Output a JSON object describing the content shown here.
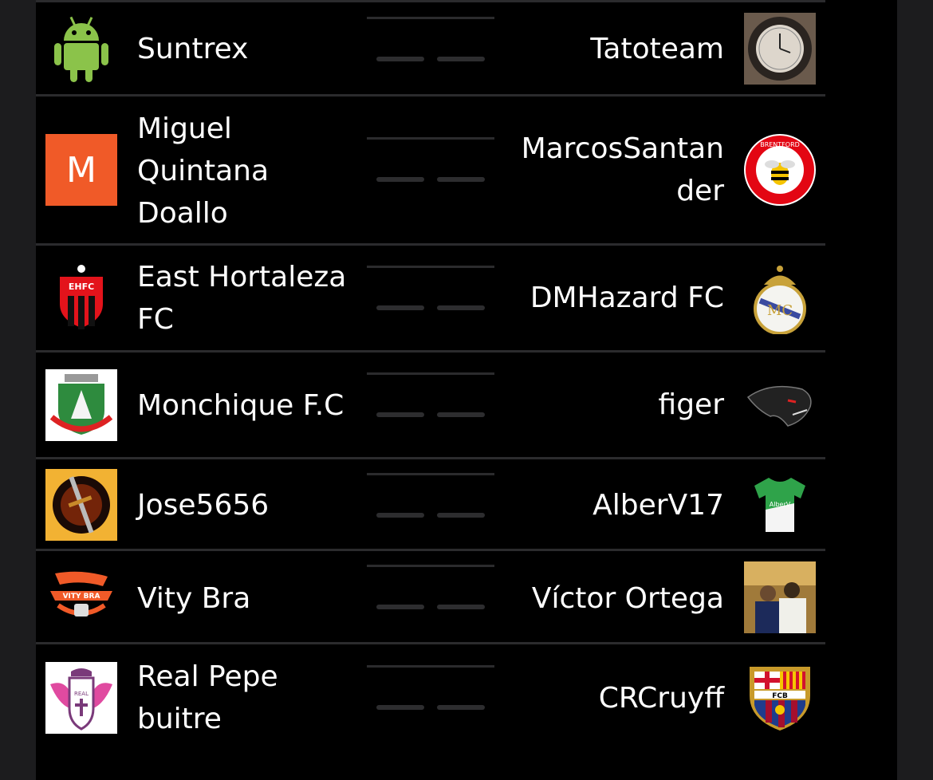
{
  "matches": [
    {
      "home": "Suntrex",
      "away": "Tatoteam",
      "home_score": "",
      "away_score": "",
      "home_badge": "android-icon",
      "away_badge": "clock-photo"
    },
    {
      "home": "Miguel Quintana Doallo",
      "away": "MarcosSantander",
      "home_score": "",
      "away_score": "",
      "home_badge": "letter-m-avatar",
      "home_badge_text": "M",
      "away_badge": "brentford-crest",
      "away_badge_text": "BRENTFORD"
    },
    {
      "home": "East Hortaleza FC",
      "away": "DMHazard FC",
      "home_score": "",
      "away_score": "",
      "home_badge": "ehfc-crest",
      "home_badge_text": "EHFC",
      "away_badge": "real-madrid-crest"
    },
    {
      "home": "Monchique F.C",
      "away": "figer",
      "home_score": "",
      "away_score": "",
      "home_badge": "monchique-crest",
      "away_badge": "panther-icon"
    },
    {
      "home": "Jose5656",
      "away": "AlberV17",
      "home_score": "",
      "away_score": "",
      "home_badge": "sword-emblem",
      "away_badge": "green-shirt-icon"
    },
    {
      "home": "Vity Bra",
      "away": "Víctor Ortega",
      "home_score": "",
      "away_score": "",
      "home_badge": "vity-bra-logo",
      "away_badge": "people-photo"
    },
    {
      "home": "Real Pepe buitre",
      "away": "CRCruyff",
      "home_score": "",
      "away_score": "",
      "home_badge": "real-pepe-crest",
      "away_badge": "fcb-crest",
      "away_badge_text": "FCB"
    }
  ],
  "colors": {
    "background": "#000000",
    "divider": "#2b2b2d",
    "dash": "#2d2d2f",
    "accent_orange": "#f05a28"
  }
}
